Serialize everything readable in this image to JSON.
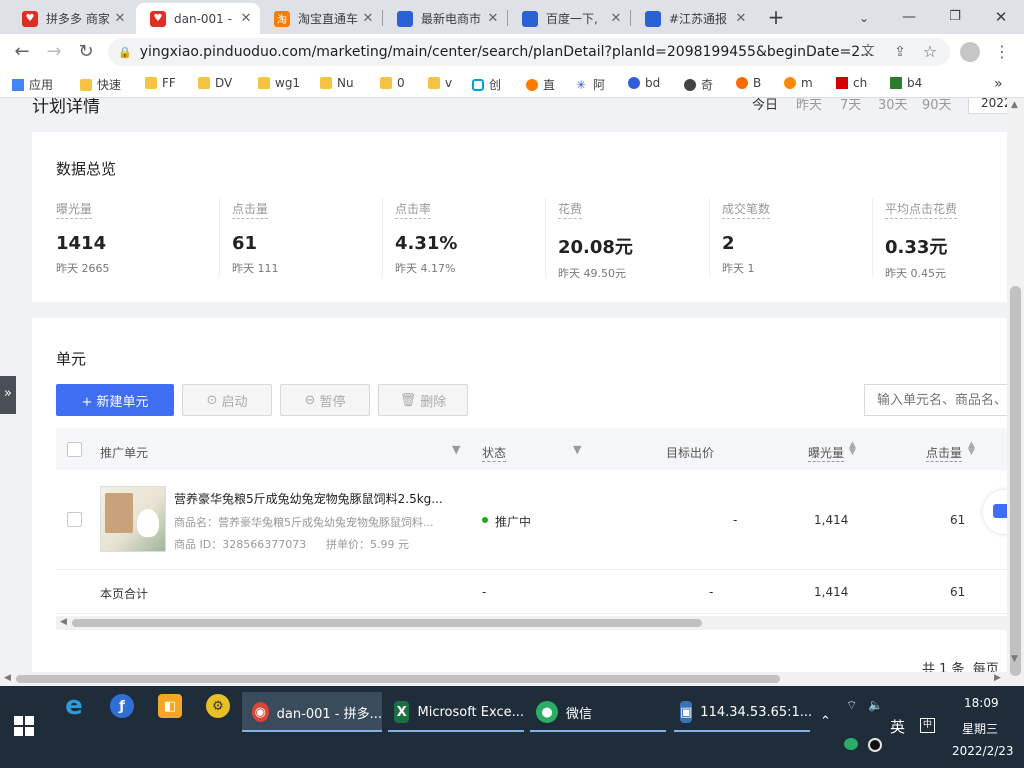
{
  "browser": {
    "tabs": [
      {
        "label": "拼多多 商家",
        "icon": "pdd-icon"
      },
      {
        "label": "dan-001 -",
        "icon": "pdd-icon"
      },
      {
        "label": "淘宝直通车",
        "icon": "taobao-icon"
      },
      {
        "label": "最新电商市",
        "icon": "baidu-icon"
      },
      {
        "label": "百度一下,",
        "icon": "baidu-icon"
      },
      {
        "label": "#江苏通报",
        "icon": "baidu-icon"
      }
    ],
    "url": "yingxiao.pinduoduo.com/marketing/main/center/search/planDetail?planId=2098199455&beginDate=2...",
    "bookmarks": [
      "应用",
      "快速",
      "FF",
      "DV",
      "wg1",
      "Nu",
      "0",
      "v",
      "创",
      "直",
      "阿",
      "bd",
      "奇",
      "B",
      "m",
      "ch",
      "b4"
    ]
  },
  "page": {
    "header_title": "计划详情",
    "date_tabs": [
      "今日",
      "昨天",
      "7天",
      "30天",
      "90天"
    ],
    "date_input": "2022"
  },
  "overview": {
    "title": "数据总览",
    "metrics": [
      {
        "label": "曝光量",
        "value": "1414",
        "yesterday": "昨天 2665"
      },
      {
        "label": "点击量",
        "value": "61",
        "yesterday": "昨天 111"
      },
      {
        "label": "点击率",
        "value": "4.31%",
        "yesterday": "昨天 4.17%"
      },
      {
        "label": "花费",
        "value": "20.08元",
        "yesterday": "昨天 49.50元"
      },
      {
        "label": "成交笔数",
        "value": "2",
        "yesterday": "昨天 1"
      },
      {
        "label": "平均点击花费",
        "value": "0.33元",
        "yesterday": "昨天 0.45元"
      }
    ]
  },
  "units": {
    "title": "单元",
    "new_button": "+ 新建单元",
    "start_button": "启动",
    "pause_button": "暂停",
    "delete_button": "删除",
    "search_placeholder": "输入单元名、商品名、",
    "columns": [
      "推广单元",
      "状态",
      "目标出价",
      "曝光量",
      "点击量"
    ],
    "row": {
      "title": "营养豪华兔粮5斤成兔幼兔宠物兔豚鼠饲料2.5kg...",
      "product_name": "商品名：营养豪华兔粮5斤成兔幼兔宠物兔豚鼠饲料...",
      "product_id": "商品 ID：328566377073",
      "group_price": "拼单价：5.99 元",
      "status": "推广中",
      "target_bid": "-",
      "impressions": "1,414",
      "clicks": "61"
    },
    "total": {
      "label": "本页合计",
      "status": "-",
      "target_bid": "-",
      "impressions": "1,414",
      "clicks": "61"
    },
    "pagination": "共 1 条  每页"
  },
  "taskbar": {
    "apps": [
      {
        "label": "dan-001 - 拼多..."
      },
      {
        "label": "Microsoft Exce..."
      },
      {
        "label": "微信"
      },
      {
        "label": "114.34.53.65:1..."
      }
    ],
    "ime": "英",
    "time": "18:09",
    "weekday": "星期三",
    "date": "2022/2/23"
  },
  "colors": {
    "primary": "#3e6ef1",
    "status_green": "#1aad19",
    "taskbar": "#1f2d3a"
  }
}
